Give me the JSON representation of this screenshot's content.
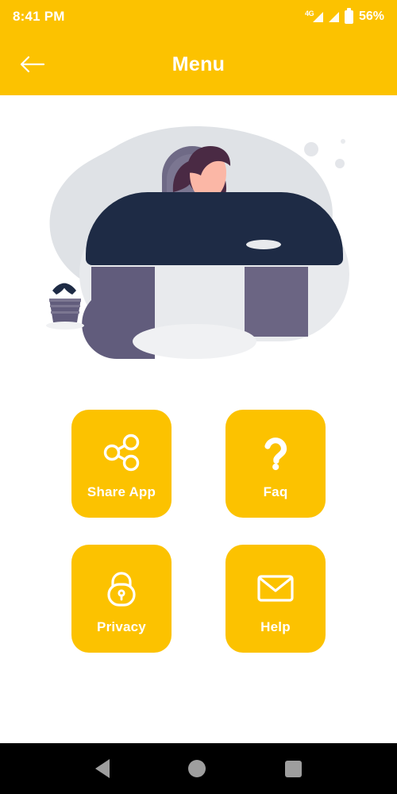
{
  "status_bar": {
    "time": "8:41 PM",
    "network_label": "4G",
    "battery_percent": "56%",
    "icons": [
      "signal-4g-icon",
      "signal-icon",
      "battery-icon"
    ]
  },
  "app_bar": {
    "title": "Menu",
    "back_icon": "arrow-left-icon"
  },
  "illustration": {
    "name": "person-at-desk-illustration",
    "alt": "Illustration of a person working at a curved office desk"
  },
  "menu": {
    "tiles": [
      {
        "label": "Share App",
        "icon": "share-icon"
      },
      {
        "label": "Faq",
        "icon": "question-mark-icon"
      },
      {
        "label": "Privacy",
        "icon": "lock-icon"
      },
      {
        "label": "Help",
        "icon": "envelope-icon"
      }
    ]
  },
  "nav_bar": {
    "back": "back-triangle-icon",
    "home": "home-circle-icon",
    "recents": "recents-square-icon"
  },
  "colors": {
    "accent": "#FCC200",
    "tile": "#FCC200",
    "on_accent": "#FFFFFF",
    "background": "#FFFFFF",
    "nav_background": "#000000",
    "nav_icon": "#9E9E9E",
    "illustration_dark": "#1E2B45",
    "illustration_mid": "#615C7C",
    "illustration_light": "#DCDEE3",
    "skin": "#FBB7A6",
    "hair": "#4A2A44"
  }
}
